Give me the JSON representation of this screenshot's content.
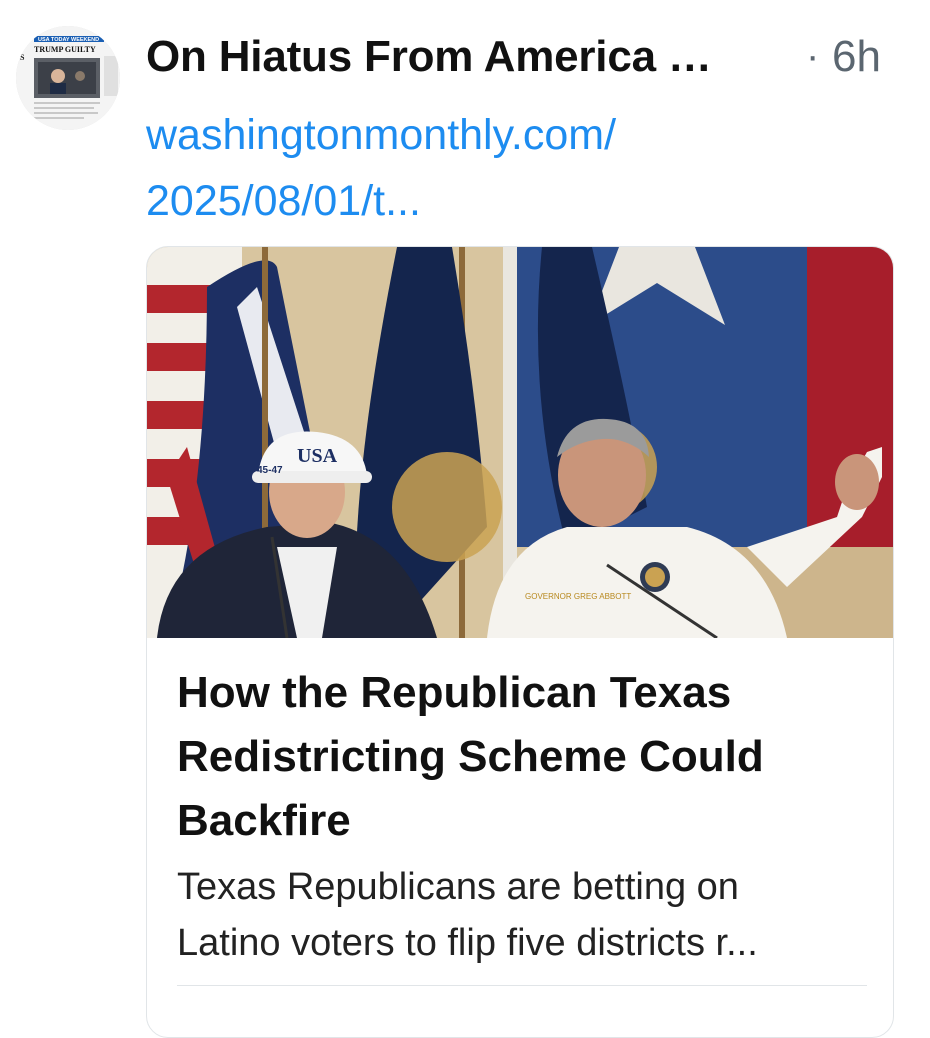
{
  "post": {
    "author": "On Hiatus From America …",
    "separator": "·",
    "age": "6h",
    "link_lines": [
      "washingtonmonthly.com/",
      "2025/08/01/t..."
    ]
  },
  "avatar": {
    "masthead": "USA TODAY WEEKEND",
    "headline": "TRUMP GUILTY",
    "side_letter": "S",
    "icon": "newspaper-thumbnail"
  },
  "card": {
    "image_caps_text": "USA",
    "image_cap_side_text": "45-47",
    "image_patch_text": "GOVERNOR GREG ABBOTT",
    "title_lines": [
      "How the Republican Texas",
      "Redistricting Scheme Could",
      "Backfire"
    ],
    "desc_lines": [
      "Texas Republicans are betting on",
      "Latino voters to flip five districts r..."
    ]
  },
  "colors": {
    "link": "#1d8cf0",
    "text": "#111111",
    "muted": "#5b6670",
    "border": "#e1e5e8"
  }
}
